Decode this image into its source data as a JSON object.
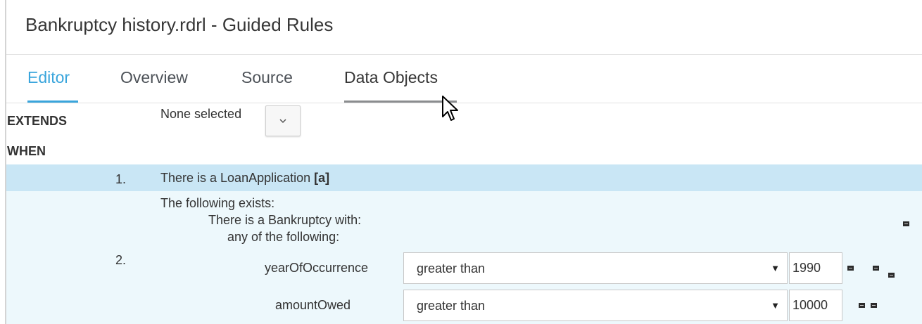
{
  "title": "Bankruptcy history.rdrl - Guided Rules",
  "tabs": [
    {
      "label": "Editor",
      "active": true
    },
    {
      "label": "Overview",
      "active": false
    },
    {
      "label": "Source",
      "active": false
    },
    {
      "label": "Data Objects",
      "active": false,
      "hovered": true
    }
  ],
  "extends": {
    "keyword": "EXTENDS",
    "value": "None selected",
    "dropdown_icon": "chevron-down-icon"
  },
  "when": {
    "keyword": "WHEN"
  },
  "conditions": [
    {
      "number": "1.",
      "text": "There is a LoanApplication",
      "binding": "[a]"
    },
    {
      "number": "2.",
      "exists_text": "The following exists:",
      "pattern_text": "There is a Bankruptcy with:",
      "group_text": "any of the following:",
      "constraints": [
        {
          "field": "yearOfOccurrence",
          "operator": "greater than",
          "value": "1990"
        },
        {
          "field": "amountOwed",
          "operator": "greater than",
          "value": "10000"
        }
      ]
    }
  ],
  "colors": {
    "accent": "#39a5dc",
    "row_selected": "#c9e6f5",
    "row_background": "#edf8fc"
  }
}
